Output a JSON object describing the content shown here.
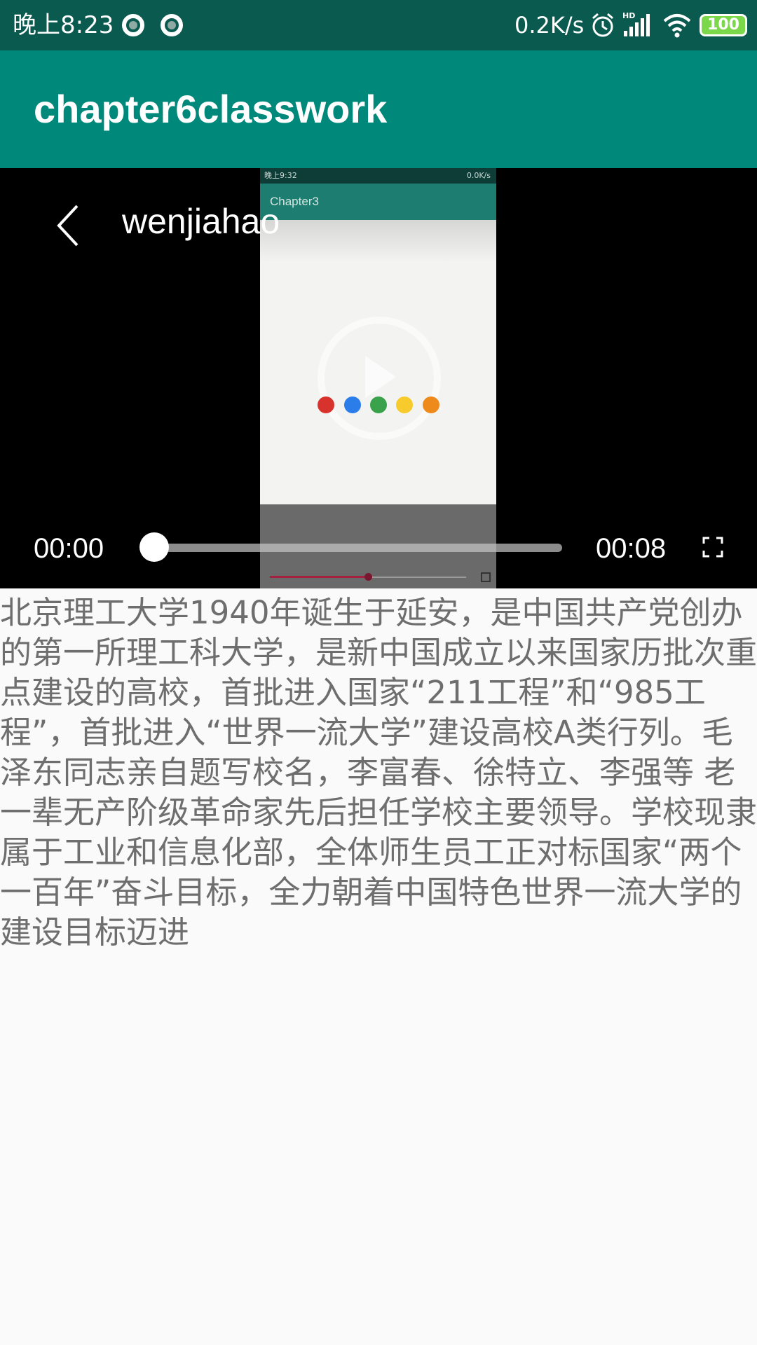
{
  "status_bar": {
    "time": "晚上8:23",
    "network_speed": "0.2K/s",
    "battery": "100",
    "icons": [
      "notification-icon",
      "notification-icon",
      "alarm-icon",
      "hd-signal-icon",
      "wifi-icon",
      "battery-icon"
    ]
  },
  "app_bar": {
    "title": "chapter6classwork",
    "color": "#00897b"
  },
  "player": {
    "title": "wenjiahao",
    "current_time": "00:00",
    "total_time": "00:08",
    "progress": 0,
    "icons": [
      "back-icon",
      "fullscreen-icon"
    ],
    "video_frame": {
      "status_time": "晚上9:32",
      "status_right": "0.0K/s",
      "app_title": "Chapter3",
      "loading_dot_colors": [
        "#d8322c",
        "#2b7de9",
        "#3aa24a",
        "#f7cb2b",
        "#ee8a1c"
      ]
    }
  },
  "description": "北京理工大学1940年诞生于延安，是中国共产党创办的第一所理工科大学，是新中国成立以来国家历批次重点建设的高校，首批进入国家“211工程”和“985工程”，首批进入“世界一流大学”建设高校A类行列。毛泽东同志亲自题写校名，李富春、徐特立、李强等 老一辈无产阶级革命家先后担任学校主要领导。学校现隶属于工业和信息化部，全体师生员工正对标国家“两个一百年”奋斗目标，全力朝着中国特色世界一流大学的建设目标迈进"
}
